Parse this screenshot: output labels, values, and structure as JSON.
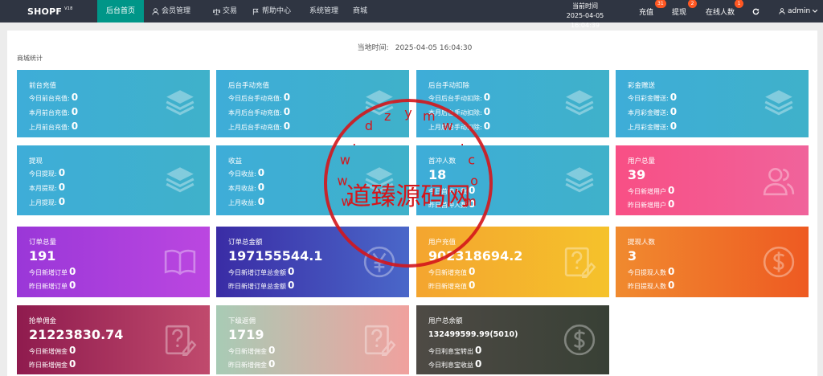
{
  "brand": {
    "name": "SHOPF",
    "version": "V18"
  },
  "nav": [
    {
      "label": "后台首页",
      "icon": "none"
    },
    {
      "label": "会员管理",
      "icon": "user-icon"
    },
    {
      "label": "交易",
      "icon": "scale-icon"
    },
    {
      "label": "帮助中心",
      "icon": "flag-icon"
    },
    {
      "label": "系统管理",
      "icon": "none"
    },
    {
      "label": "商城",
      "icon": "none"
    }
  ],
  "header": {
    "time_label": "当前时间",
    "time_value": "2025-04-05 16:04:39",
    "recharge": {
      "label": "充值",
      "badge": "31"
    },
    "withdraw": {
      "label": "提现",
      "badge": "2"
    },
    "online": {
      "label": "在线人数",
      "badge": "1"
    },
    "user": "admin"
  },
  "current_time": {
    "label": "当地时间:",
    "value": "2025-04-05 16:04:30"
  },
  "section_title": "商城统计",
  "cards": [
    {
      "title": "前台充值",
      "lines": [
        {
          "label": "今日前台充值:",
          "value": "0"
        },
        {
          "label": "本月前台充值:",
          "value": "0"
        },
        {
          "label": "上月前台充值:",
          "value": "0"
        }
      ]
    },
    {
      "title": "后台手动充值",
      "lines": [
        {
          "label": "今日后台手动充值:",
          "value": "0"
        },
        {
          "label": "本月后台手动充值:",
          "value": "0"
        },
        {
          "label": "上月后台手动充值:",
          "value": "0"
        }
      ]
    },
    {
      "title": "后台手动扣除",
      "lines": [
        {
          "label": "今日后台手动扣除:",
          "value": "0"
        },
        {
          "label": "本月后台手动扣除:",
          "value": "0"
        },
        {
          "label": "上月后台手动扣除:",
          "value": "0"
        }
      ]
    },
    {
      "title": "彩金赠送",
      "lines": [
        {
          "label": "今日彩金赠送:",
          "value": "0"
        },
        {
          "label": "本月彩金赠送:",
          "value": "0"
        },
        {
          "label": "上月彩金赠送:",
          "value": "0"
        }
      ]
    },
    {
      "title": "提现",
      "lines": [
        {
          "label": "今日提现:",
          "value": "0"
        },
        {
          "label": "本月提现:",
          "value": "0"
        },
        {
          "label": "上月提现:",
          "value": "0"
        }
      ]
    },
    {
      "title": "收益",
      "lines": [
        {
          "label": "今日收益:",
          "value": "0"
        },
        {
          "label": "本月收益:",
          "value": "0"
        },
        {
          "label": "上月收益:",
          "value": "0"
        }
      ]
    },
    {
      "title": "首冲人数",
      "big": "18",
      "lines": [
        {
          "label": "今日首冲人数",
          "value": "0"
        },
        {
          "label": "昨日首冲人数",
          "value": "0"
        }
      ]
    },
    {
      "title": "用户总量",
      "big": "39",
      "lines": [
        {
          "label": "今日新增用户",
          "value": "0"
        },
        {
          "label": "昨日新增用户",
          "value": "0"
        }
      ]
    },
    {
      "title": "订单总量",
      "big": "191",
      "lines": [
        {
          "label": "今日新增订单",
          "value": "0"
        },
        {
          "label": "昨日新增订单",
          "value": "0"
        }
      ]
    },
    {
      "title": "订单总金额",
      "big": "197155544.1",
      "lines": [
        {
          "label": "今日新增订单总金额",
          "value": "0"
        },
        {
          "label": "昨日新增订单总金额",
          "value": "0"
        }
      ]
    },
    {
      "title": "用户充值",
      "big": "902318694.2",
      "lines": [
        {
          "label": "今日新增充值",
          "value": "0"
        },
        {
          "label": "昨日新增充值",
          "value": "0"
        }
      ]
    },
    {
      "title": "提现人数",
      "big": "3",
      "lines": [
        {
          "label": "今日提现人数",
          "value": "0"
        },
        {
          "label": "昨日提现人数",
          "value": "0"
        }
      ]
    },
    {
      "title": "抢单佣金",
      "big": "21223830.74",
      "lines": [
        {
          "label": "今日新增佣金",
          "value": "0"
        },
        {
          "label": "昨日新增佣金",
          "value": "0"
        }
      ]
    },
    {
      "title": "下级返佣",
      "big": "1719",
      "lines": [
        {
          "label": "今日新增佣金",
          "value": "0"
        },
        {
          "label": "昨日新增佣金",
          "value": "0"
        }
      ]
    },
    {
      "title": "用户总余额",
      "big": "132499599.99(5010)",
      "lines": [
        {
          "label": "今日利息宝转出",
          "value": "0"
        },
        {
          "label": "今日利息宝收益",
          "value": "0"
        }
      ]
    }
  ],
  "watermark": {
    "text": "道臻源码网",
    "url": "www.dzymw.com"
  }
}
